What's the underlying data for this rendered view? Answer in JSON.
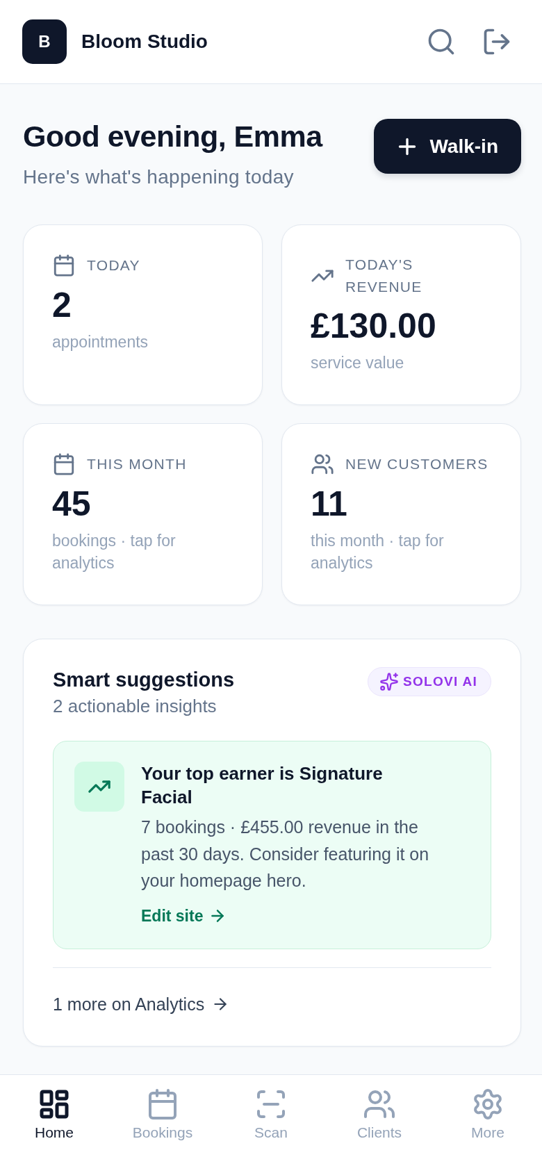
{
  "header": {
    "logo": "B",
    "title": "Bloom Studio"
  },
  "greeting": {
    "title": "Good evening, Emma",
    "subtitle": "Here's what's happening today",
    "button": "Walk-in"
  },
  "stats": [
    {
      "label": "TODAY",
      "value": "2",
      "caption": "appointments"
    },
    {
      "label": "TODAY'S REVENUE",
      "value": "£130.00",
      "caption": "service value"
    },
    {
      "label": "THIS MONTH",
      "value": "45",
      "caption": "bookings · tap for analytics"
    },
    {
      "label": "NEW CUSTOMERS",
      "value": "11",
      "caption": "this month · tap for analytics"
    }
  ],
  "suggestions": {
    "title": "Smart suggestions",
    "subtitle": "2 actionable insights",
    "badge": "SOLOVI AI",
    "items": [
      {
        "title": "Your top earner is Signature Facial",
        "body": "7 bookings · £455.00 revenue in the past 30 days. Consider featuring it on your homepage hero.",
        "action": "Edit site"
      }
    ],
    "more_link": "1 more on Analytics"
  },
  "nav": [
    {
      "label": "Home",
      "selected": true
    },
    {
      "label": "Bookings",
      "selected": false
    },
    {
      "label": "Scan",
      "selected": false
    },
    {
      "label": "Clients",
      "selected": false
    },
    {
      "label": "More",
      "selected": false
    }
  ]
}
